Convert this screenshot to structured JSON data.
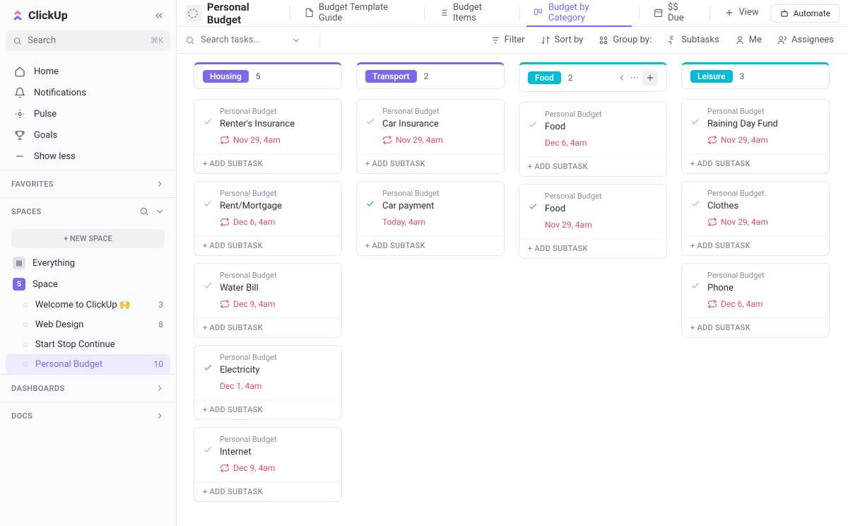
{
  "app": {
    "name": "ClickUp"
  },
  "sidebar": {
    "search_placeholder": "Search",
    "search_kbd": "⌘K",
    "nav": [
      {
        "label": "Home"
      },
      {
        "label": "Notifications"
      },
      {
        "label": "Pulse"
      },
      {
        "label": "Goals"
      },
      {
        "label": "Show less"
      }
    ],
    "favorites_label": "FAVORITES",
    "spaces_label": "SPACES",
    "new_space_label": "+  NEW SPACE",
    "everything_label": "Everything",
    "space_label": "Space",
    "space_items": [
      {
        "label": "Welcome to ClickUp 🙌",
        "count": "3"
      },
      {
        "label": "Web Design",
        "count": "8"
      },
      {
        "label": "Start Stop Continue",
        "count": ""
      },
      {
        "label": "Personal Budget",
        "count": "10"
      }
    ],
    "dashboards_label": "DASHBOARDS",
    "docs_label": "DOCS"
  },
  "topbar": {
    "title": "Personal Budget",
    "tabs": [
      {
        "label": "Budget Template Guide"
      },
      {
        "label": "Budget Items"
      },
      {
        "label": "Budget by Category"
      },
      {
        "label": "$$ Due"
      },
      {
        "label": "View"
      }
    ],
    "automate_label": "Automate"
  },
  "toolbar": {
    "search_placeholder": "Search tasks...",
    "filter": "Filter",
    "sort_by": "Sort by",
    "group_by": "Group by:",
    "subtasks": "Subtasks",
    "me": "Me",
    "assignees": "Assignees"
  },
  "add_subtask_label": "+ ADD SUBTASK",
  "card_space_label": "Personal Budget",
  "columns": [
    {
      "name": "Housing",
      "count": "5",
      "color": "#7b68ee",
      "cards": [
        {
          "title": "Renter's Insurance",
          "date": "Nov 29, 4am",
          "recurring": true,
          "done": false
        },
        {
          "title": "Rent/Mortgage",
          "date": "Dec 6, 4am",
          "recurring": true,
          "done": false
        },
        {
          "title": "Water Bill",
          "date": "Dec 9, 4am",
          "recurring": true,
          "done": false
        },
        {
          "title": "Electricity",
          "date": "Dec 1, 4am",
          "recurring": false,
          "done": true
        },
        {
          "title": "Internet",
          "date": "Dec 9, 4am",
          "recurring": true,
          "done": false
        }
      ]
    },
    {
      "name": "Transport",
      "count": "2",
      "color": "#7b68ee",
      "cards": [
        {
          "title": "Car Insurance",
          "date": "Nov 29, 4am",
          "recurring": true,
          "done": false
        },
        {
          "title": "Car payment",
          "date": "Today, 4am",
          "recurring": false,
          "done": true
        }
      ]
    },
    {
      "name": "Food",
      "count": "2",
      "color": "#02BCD4",
      "show_actions": true,
      "cards": [
        {
          "title": "Food",
          "date": "Dec 6, 4am",
          "recurring": false,
          "done": false
        },
        {
          "title": "Food",
          "date": "Nov 29, 4am",
          "recurring": false,
          "done": true
        }
      ]
    },
    {
      "name": "Leisure",
      "count": "3",
      "color": "#02BCD4",
      "cards": [
        {
          "title": "Raining Day Fund",
          "date": "Nov 29, 4am",
          "recurring": true,
          "done": false
        },
        {
          "title": "Clothes",
          "date": "Nov 29, 4am",
          "recurring": true,
          "done": false
        },
        {
          "title": "Phone",
          "date": "Dec 6, 4am",
          "recurring": true,
          "done": false
        }
      ]
    }
  ]
}
